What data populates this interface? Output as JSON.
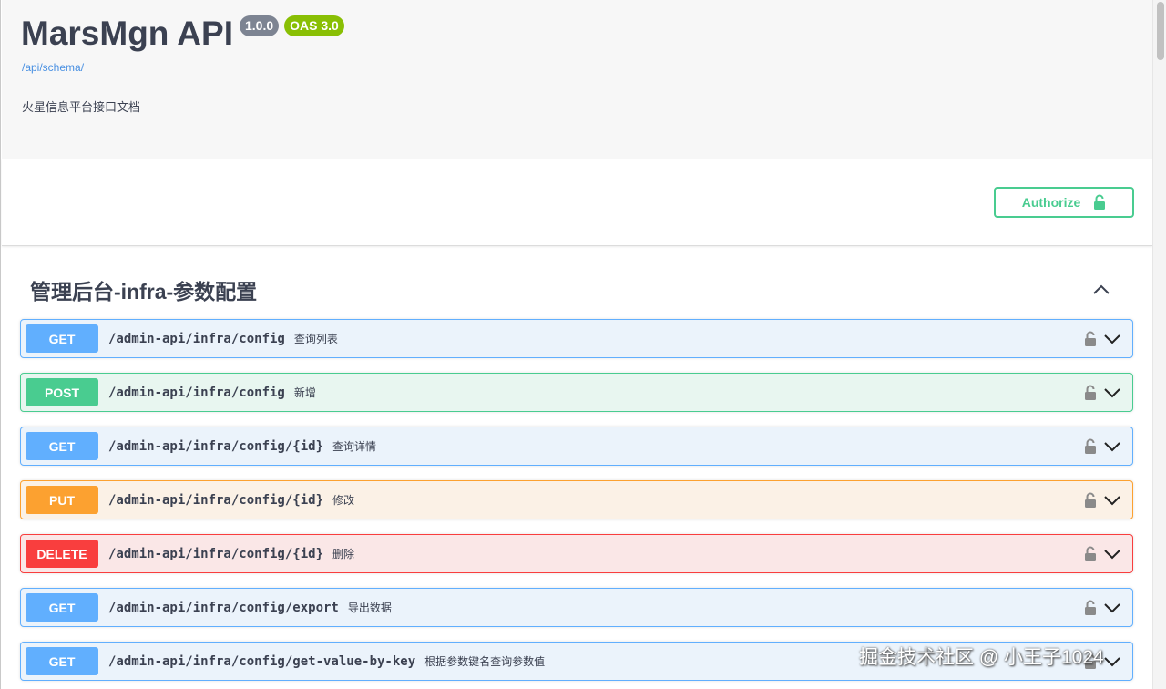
{
  "info": {
    "title": "MarsMgn API",
    "version": "1.0.0",
    "oas_badge": "OAS 3.0",
    "schema_link": "/api/schema/",
    "description": "火星信息平台接口文档"
  },
  "auth": {
    "authorize_label": "Authorize",
    "icon": "unlock-icon"
  },
  "section": {
    "title": "管理后台-infra-参数配置",
    "expanded": true
  },
  "operations": [
    {
      "method": "GET",
      "path": "/admin-api/infra/config",
      "summary": "查询列表"
    },
    {
      "method": "POST",
      "path": "/admin-api/infra/config",
      "summary": "新增"
    },
    {
      "method": "GET",
      "path": "/admin-api/infra/config/{id}",
      "summary": "查询详情"
    },
    {
      "method": "PUT",
      "path": "/admin-api/infra/config/{id}",
      "summary": "修改"
    },
    {
      "method": "DELETE",
      "path": "/admin-api/infra/config/{id}",
      "summary": "删除"
    },
    {
      "method": "GET",
      "path": "/admin-api/infra/config/export",
      "summary": "导出数据"
    },
    {
      "method": "GET",
      "path": "/admin-api/infra/config/get-value-by-key",
      "summary": "根据参数键名查询参数值"
    }
  ],
  "colors": {
    "get": "#61affe",
    "post": "#49cc90",
    "put": "#fca130",
    "delete": "#f93e3e",
    "authorize": "#49cc90",
    "link": "#4990e2"
  },
  "watermark": "掘金技术社区 @ 小王子1024"
}
